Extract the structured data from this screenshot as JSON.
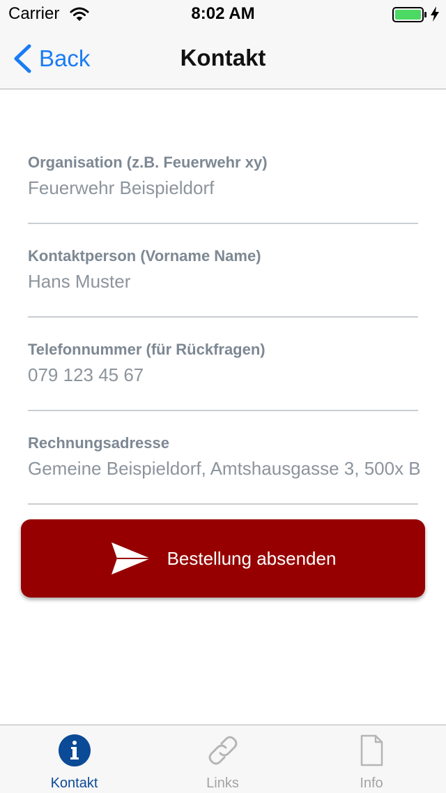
{
  "status_bar": {
    "carrier": "Carrier",
    "time": "8:02 AM"
  },
  "nav": {
    "back_label": "Back",
    "title": "Kontakt"
  },
  "form": {
    "fields": [
      {
        "label": "Organisation (z.B. Feuerwehr xy)",
        "value": "Feuerwehr Beispieldorf"
      },
      {
        "label": "Kontaktperson (Vorname Name)",
        "value": "Hans Muster"
      },
      {
        "label": "Telefonnummer (für Rückfragen)",
        "value": "079 123 45 67"
      },
      {
        "label": "Rechnungsadresse",
        "value": "Gemeine Beispieldorf, Amtshausgasse 3, 500x B"
      }
    ],
    "submit_label": "Bestellung absenden"
  },
  "tabs": [
    {
      "label": "Kontakt",
      "icon": "info-icon",
      "active": true
    },
    {
      "label": "Links",
      "icon": "link-icon",
      "active": false
    },
    {
      "label": "Info",
      "icon": "document-icon",
      "active": false
    }
  ],
  "colors": {
    "accent_blue": "#1a7cf5",
    "submit_red": "#960000",
    "active_tab": "#0b4a96",
    "inactive_tab": "#a3a3a3",
    "battery_green": "#4cd964"
  }
}
